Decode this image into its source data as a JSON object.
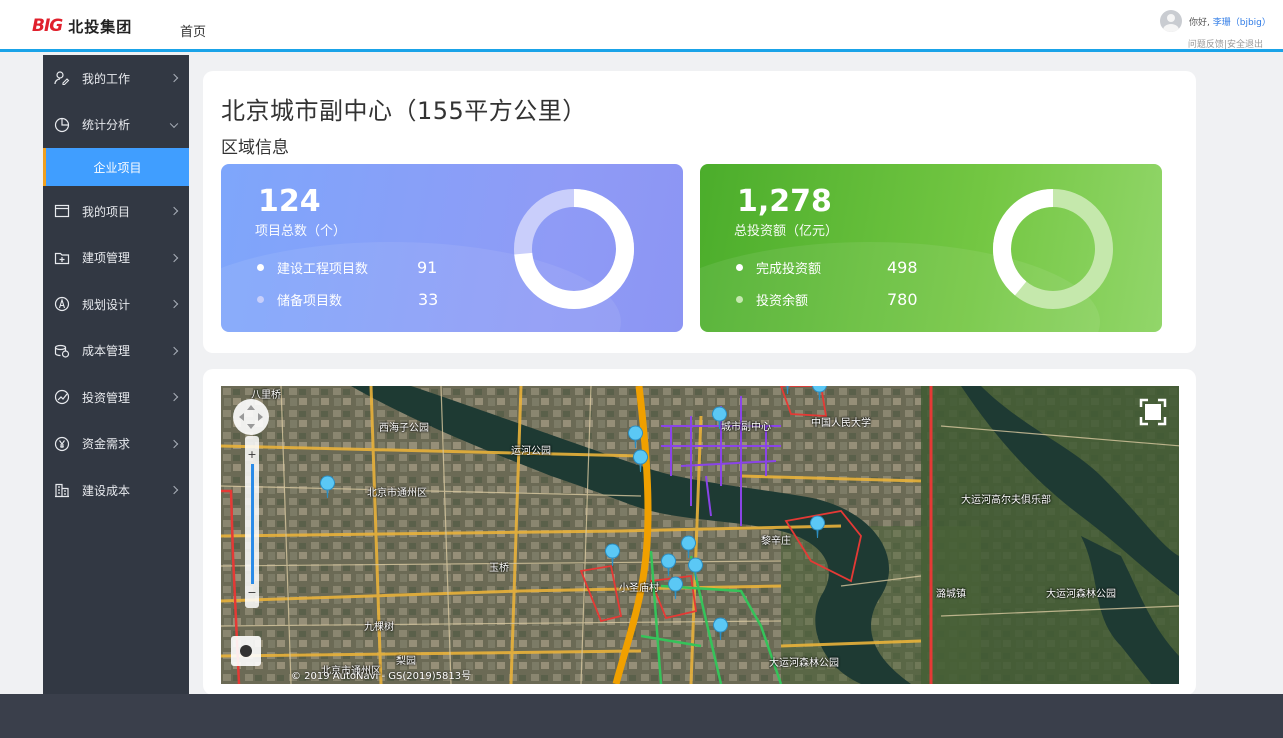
{
  "header": {
    "logo_mark": "BIG",
    "logo_text": "北投集团",
    "nav_home": "首页",
    "greeting_prefix": "你好,",
    "user_name": "李珊（bjbig）",
    "link_feedback": "问题反馈",
    "link_separator": "|",
    "link_logout": "安全退出"
  },
  "sidebar": {
    "items": [
      {
        "label": "我的工作",
        "icon": "user-edit-icon"
      },
      {
        "label": "统计分析",
        "icon": "pie-chart-icon"
      },
      {
        "label": "企业项目"
      },
      {
        "label": "我的项目",
        "icon": "window-icon"
      },
      {
        "label": "建项管理",
        "icon": "folder-add-icon"
      },
      {
        "label": "规划设计",
        "icon": "compass-icon"
      },
      {
        "label": "成本管理",
        "icon": "coins-icon"
      },
      {
        "label": "投资管理",
        "icon": "trend-icon"
      },
      {
        "label": "资金需求",
        "icon": "yen-icon"
      },
      {
        "label": "建设成本",
        "icon": "building-icon"
      }
    ]
  },
  "main": {
    "title": "北京城市副中心（155平方公里）",
    "section": "区域信息",
    "card_projects": {
      "total": "124",
      "total_label": "项目总数（个）",
      "rows": [
        {
          "label": "建设工程项目数",
          "value": "91"
        },
        {
          "label": "储备项目数",
          "value": "33"
        }
      ],
      "share": 0.734
    },
    "card_investment": {
      "total": "1,278",
      "total_label": "总投资额（亿元）",
      "rows": [
        {
          "label": "完成投资额",
          "value": "498"
        },
        {
          "label": "投资余额",
          "value": "780"
        }
      ],
      "share": 0.39
    }
  },
  "map": {
    "labels": [
      "八里桥",
      "西海子公园",
      "运河公园",
      "北京市通州区",
      "玉桥",
      "九棵树",
      "梨园",
      "北京市通州区",
      "小圣庙村",
      "黎辛庄",
      "大运河森林公园",
      "中国人民大学",
      "城市副中心",
      "大运河高尔夫俱乐部",
      "潞城镇",
      "大运河森林公园"
    ],
    "copyright": "© 2019 AutoNavi - GS(2019)5813号",
    "colors": {
      "marker": "#5bc8f5",
      "river": "#1e3a33",
      "road_main": "#f0a000",
      "boundary": "#e53935"
    }
  },
  "colors": {
    "accent": "#409eff",
    "sidebar_bg": "#323843",
    "header_border": "#1aa3e8"
  }
}
